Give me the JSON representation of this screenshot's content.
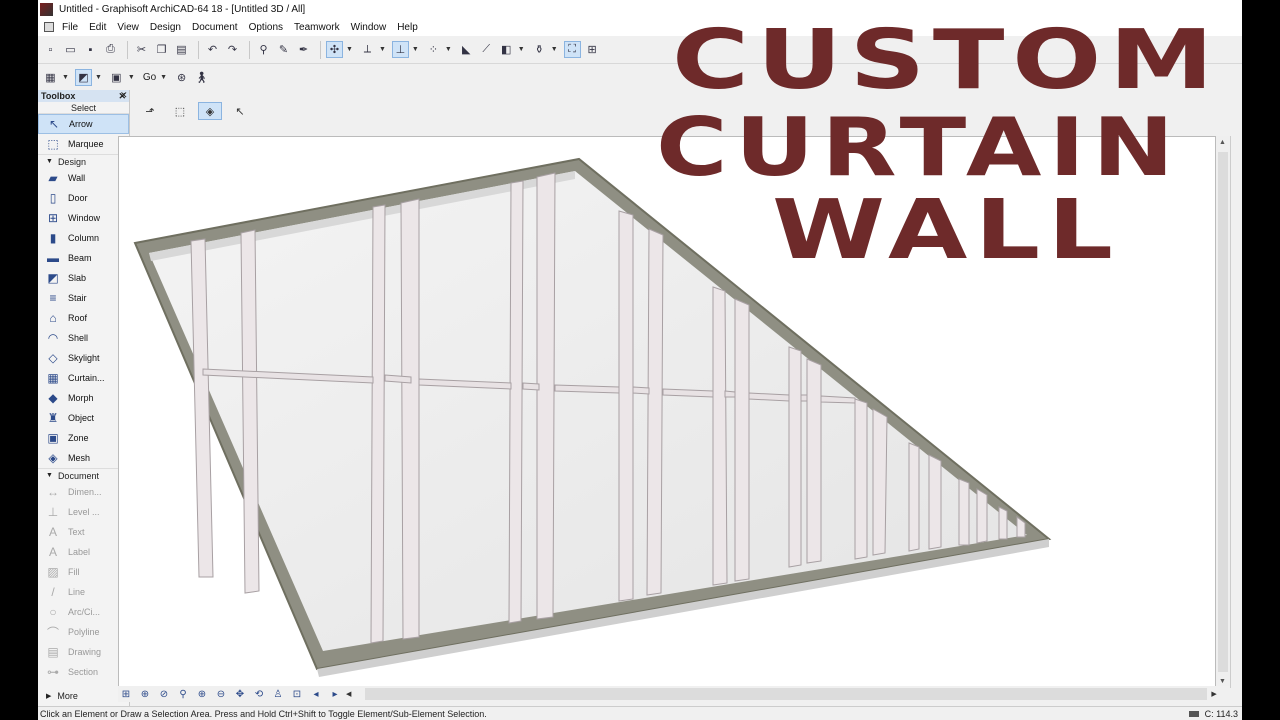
{
  "window": {
    "title": "Untitled - Graphisoft ArchiCAD-64 18 - [Untitled 3D / All]"
  },
  "menu": [
    "File",
    "Edit",
    "View",
    "Design",
    "Document",
    "Options",
    "Teamwork",
    "Window",
    "Help"
  ],
  "toolbar2": {
    "go_label": "Go"
  },
  "toolbox": {
    "title": "Toolbox",
    "select_label": "Select",
    "select_tools": [
      {
        "label": "Arrow",
        "icon": "arrow-icon",
        "glyph": "↖"
      },
      {
        "label": "Marquee",
        "icon": "marquee-icon",
        "glyph": "⬚"
      }
    ],
    "design_label": "Design",
    "design_tools": [
      {
        "label": "Wall",
        "icon": "wall-icon",
        "glyph": "▰"
      },
      {
        "label": "Door",
        "icon": "door-icon",
        "glyph": "▯"
      },
      {
        "label": "Window",
        "icon": "window-icon",
        "glyph": "⊞"
      },
      {
        "label": "Column",
        "icon": "column-icon",
        "glyph": "▮"
      },
      {
        "label": "Beam",
        "icon": "beam-icon",
        "glyph": "▬"
      },
      {
        "label": "Slab",
        "icon": "slab-icon",
        "glyph": "◩"
      },
      {
        "label": "Stair",
        "icon": "stair-icon",
        "glyph": "≡"
      },
      {
        "label": "Roof",
        "icon": "roof-icon",
        "glyph": "⌂"
      },
      {
        "label": "Shell",
        "icon": "shell-icon",
        "glyph": "◠"
      },
      {
        "label": "Skylight",
        "icon": "skylight-icon",
        "glyph": "◇"
      },
      {
        "label": "Curtain...",
        "icon": "curtain-wall-icon",
        "glyph": "▦"
      },
      {
        "label": "Morph",
        "icon": "morph-icon",
        "glyph": "◆"
      },
      {
        "label": "Object",
        "icon": "object-icon",
        "glyph": "♜"
      },
      {
        "label": "Zone",
        "icon": "zone-icon",
        "glyph": "▣"
      },
      {
        "label": "Mesh",
        "icon": "mesh-icon",
        "glyph": "◈"
      }
    ],
    "document_label": "Document",
    "document_tools": [
      {
        "label": "Dimen...",
        "icon": "dimension-icon",
        "glyph": "↔"
      },
      {
        "label": "Level ...",
        "icon": "level-dimension-icon",
        "glyph": "⊥"
      },
      {
        "label": "Text",
        "icon": "text-icon",
        "glyph": "A"
      },
      {
        "label": "Label",
        "icon": "label-icon",
        "glyph": "A"
      },
      {
        "label": "Fill",
        "icon": "fill-icon",
        "glyph": "▨"
      },
      {
        "label": "Line",
        "icon": "line-icon",
        "glyph": "/"
      },
      {
        "label": "Arc/Ci...",
        "icon": "arc-circle-icon",
        "glyph": "○"
      },
      {
        "label": "Polyline",
        "icon": "polyline-icon",
        "glyph": "⌒"
      },
      {
        "label": "Drawing",
        "icon": "drawing-icon",
        "glyph": "▤"
      },
      {
        "label": "Section",
        "icon": "section-icon",
        "glyph": "⊶"
      }
    ],
    "more_label": "More"
  },
  "overlay": {
    "line1": "CUSTOM",
    "line2": "CURTAIN",
    "line3": "WALL",
    "color": "#6e2a2a"
  },
  "status": {
    "hint": "Click an Element or Draw a Selection Area. Press and Hold Ctrl+Shift to Toggle Element/Sub-Element Selection.",
    "coord": "C: 114.3"
  }
}
